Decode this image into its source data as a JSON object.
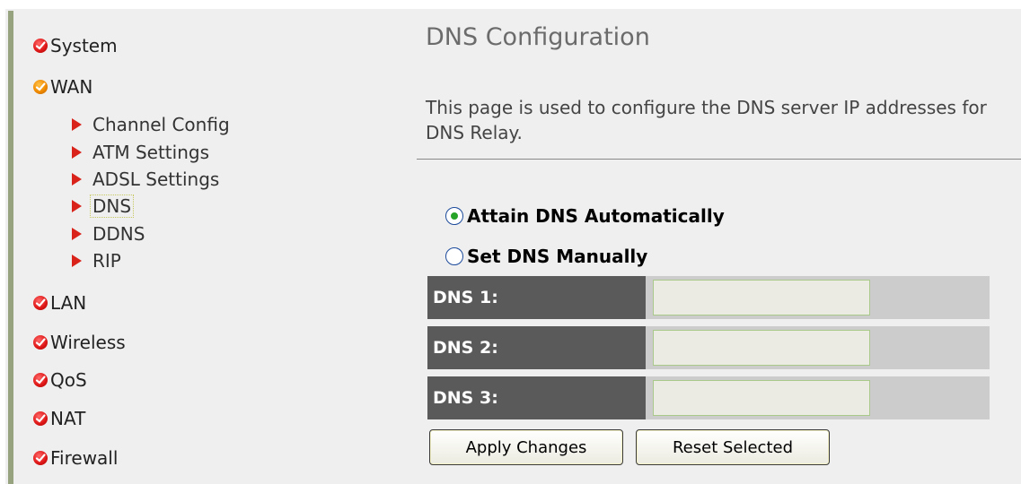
{
  "sidebar": {
    "menu": [
      {
        "label": "System",
        "icon": "red-check-icon"
      },
      {
        "label": "WAN",
        "icon": "orange-check-icon"
      },
      {
        "label": "LAN",
        "icon": "red-check-icon"
      },
      {
        "label": "Wireless",
        "icon": "red-check-icon"
      },
      {
        "label": "QoS",
        "icon": "red-check-icon"
      },
      {
        "label": "NAT",
        "icon": "red-check-icon"
      },
      {
        "label": "Firewall",
        "icon": "red-check-icon"
      }
    ],
    "wan_submenu": [
      {
        "label": "Channel Config"
      },
      {
        "label": "ATM Settings"
      },
      {
        "label": "ADSL Settings"
      },
      {
        "label": "DNS",
        "active": true
      },
      {
        "label": "DDNS"
      },
      {
        "label": "RIP"
      }
    ]
  },
  "main": {
    "title": "DNS Configuration",
    "description": "This page is used to configure the DNS server IP addresses for DNS Relay.",
    "radio_auto": {
      "label": "Attain DNS Automatically",
      "checked": true
    },
    "radio_manual": {
      "label": "Set DNS Manually",
      "checked": false
    },
    "dns_fields": [
      {
        "label": "DNS 1:",
        "value": ""
      },
      {
        "label": "DNS 2:",
        "value": ""
      },
      {
        "label": "DNS 3:",
        "value": ""
      }
    ],
    "apply_button": "Apply Changes",
    "reset_button": "Reset Selected"
  },
  "colors": {
    "accent_red": "#e11919",
    "accent_orange": "#f08a00",
    "label_bg": "#5a5a5a",
    "radio_dot": "#27a327"
  }
}
